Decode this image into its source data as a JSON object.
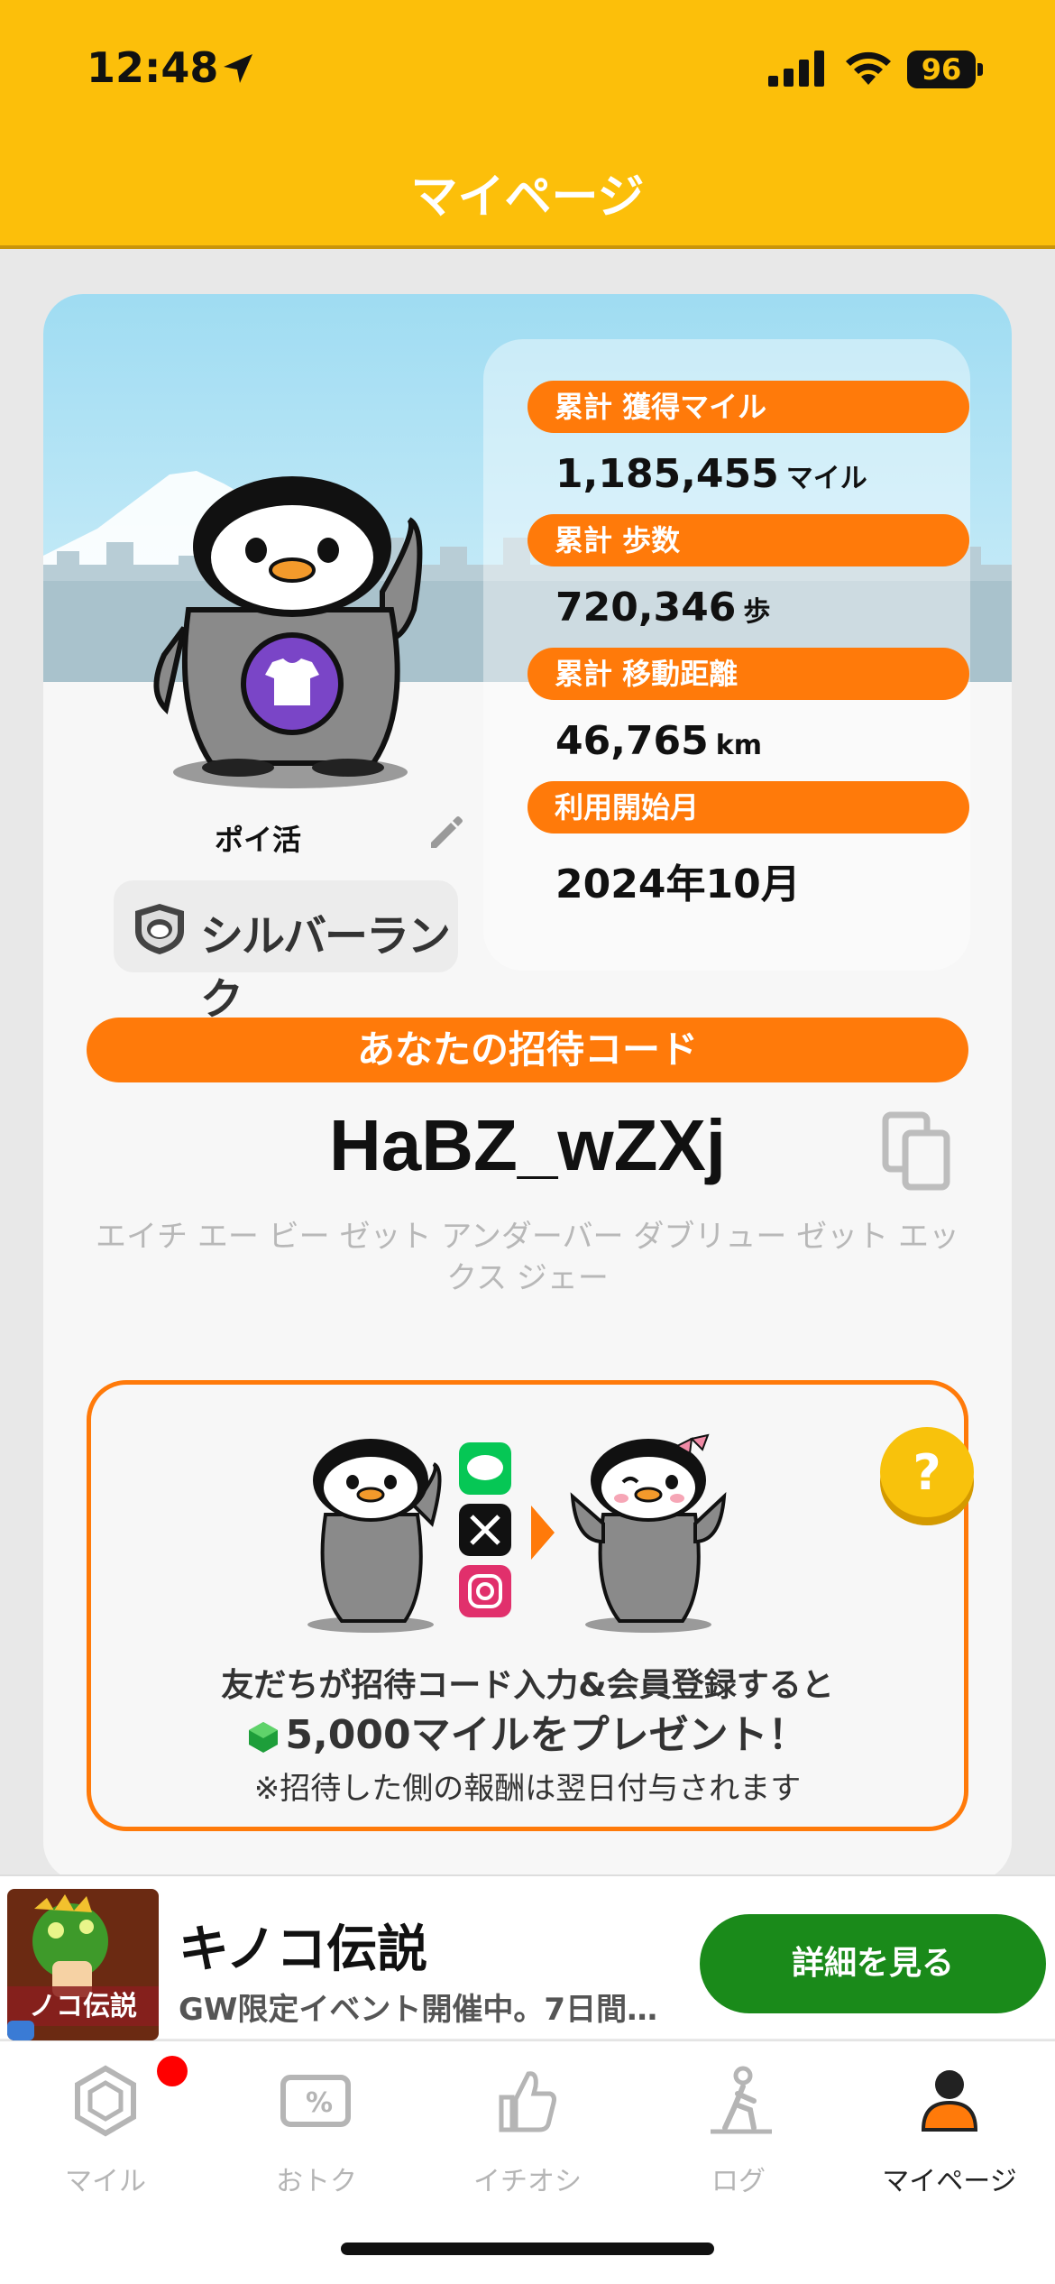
{
  "status_bar": {
    "time": "12:48",
    "battery": "96"
  },
  "header": {
    "title": "マイページ"
  },
  "stats": [
    {
      "label": "累計 獲得マイル",
      "value": "1,185,455",
      "unit": "マイル"
    },
    {
      "label": "累計 歩数",
      "value": "720,346",
      "unit": "歩"
    },
    {
      "label": "累計 移動距離",
      "value": "46,765",
      "unit": "km"
    },
    {
      "label": "利用開始月",
      "value": "2024年10月",
      "unit": ""
    }
  ],
  "profile": {
    "nickname": "ポイ活",
    "rank": "シルバーランク"
  },
  "invite": {
    "heading": "あなたの招待コード",
    "code": "HaBZ_wZXj",
    "reading": "エイチ エー ビー ゼット アンダーバー ダブリュー ゼット エックス ジェー"
  },
  "promo": {
    "line1": "友だちが招待コード入力&会員登録すると",
    "line2": "5,000マイルをプレゼント！",
    "line3": "※招待した側の報酬は翌日付与されます",
    "help": "?"
  },
  "ad": {
    "title": "キノコ伝説",
    "description": "GW限定イベント開催中。7日間…",
    "button": "詳細を見る",
    "thumb_text": "ノコ伝説"
  },
  "tabs": [
    {
      "label": "マイル",
      "icon": "gem-icon"
    },
    {
      "label": "おトク",
      "icon": "coupon-icon"
    },
    {
      "label": "イチオシ",
      "icon": "thumbs-up-icon"
    },
    {
      "label": "ログ",
      "icon": "walking-icon"
    },
    {
      "label": "マイページ",
      "icon": "person-icon"
    }
  ],
  "colors": {
    "header": "#fcbf0a",
    "accent": "#ff7a0a",
    "ad_button": "#1a8a1a"
  }
}
